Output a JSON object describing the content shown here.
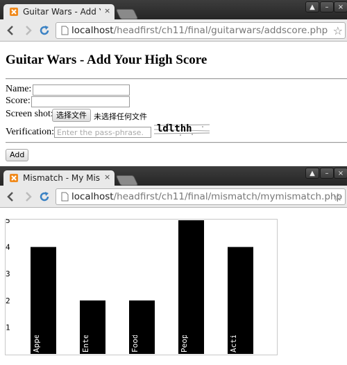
{
  "windows": {
    "top": {
      "tab_title": "Guitar Wars - Add Yo",
      "url_host": "localhost",
      "url_path": "/headfirst/ch11/final/guitarwars/addscore.php"
    },
    "bottom": {
      "tab_title": "Mismatch - My Mism",
      "url_host": "localhost",
      "url_path": "/headfirst/ch11/final/mismatch/mymismatch.php"
    }
  },
  "browser": {
    "tab_close": "×",
    "window_controls": [
      "▲",
      "–",
      "×"
    ],
    "icons": [
      "back-icon",
      "forward-icon",
      "reload-icon",
      "page-icon",
      "star-icon",
      "close-icon"
    ]
  },
  "form": {
    "heading": "Guitar Wars - Add Your High Score",
    "name_label": "Name:",
    "name_value": "",
    "score_label": "Score:",
    "score_value": "",
    "screenshot_label": "Screen shot:",
    "file_button": "选择文件",
    "no_file_text": "未选择任何文件",
    "verification_label": "Verification:",
    "verification_placeholder": "Enter the pass-phrase.",
    "captcha_text": "ldlthh",
    "add_button": "Add"
  },
  "colors": {
    "chrome_dark": "#2b2b2b",
    "toolbar": "#e9e9e9",
    "reload_blue": "#3b82c4",
    "bar": "#000000"
  },
  "chart_data": {
    "type": "bar",
    "categories": [
      "Appearance",
      "Entertainment",
      "Food",
      "People",
      "Activities"
    ],
    "values": [
      4,
      2,
      2,
      5,
      4
    ],
    "yticks": [
      1,
      2,
      3,
      4,
      5
    ],
    "ylim": [
      0,
      5
    ],
    "title": "",
    "xlabel": "",
    "ylabel": "",
    "grid": false
  }
}
